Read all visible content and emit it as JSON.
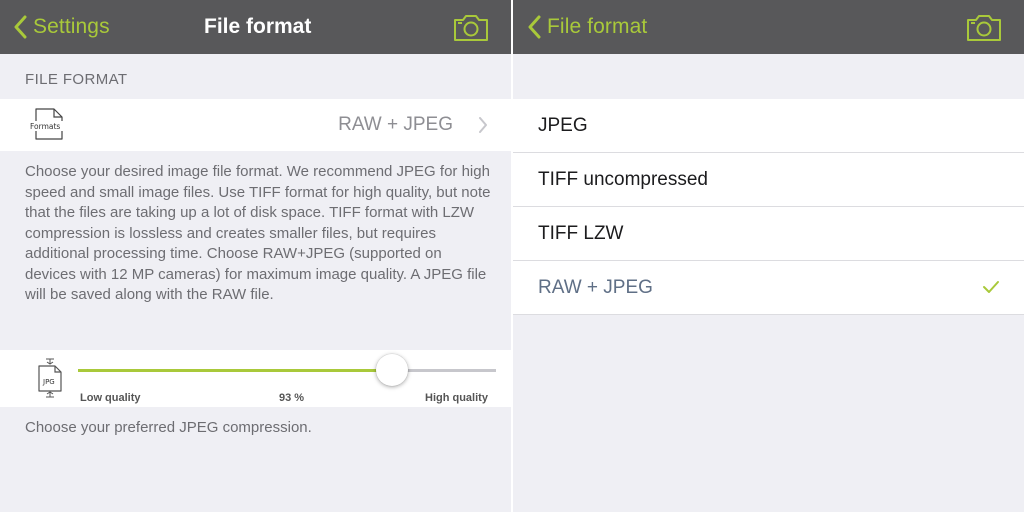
{
  "colors": {
    "accent": "#a9c93a",
    "navbar": "#58585a",
    "grouped_background": "#efeff4",
    "secondary_text": "#6d6d72",
    "selected_option_text": "#5f6f86"
  },
  "left": {
    "navbar": {
      "back_label": "Settings",
      "title": "File format",
      "back_icon": "chevron-left-icon",
      "right_icon": "camera-icon"
    },
    "section_header": "FILE FORMAT",
    "format_row": {
      "icon": "formats-file-icon",
      "icon_text": "Formats",
      "value": "RAW + JPEG",
      "accessory_icon": "chevron-right-icon"
    },
    "description": "Choose your desired image file format. We recommend JPEG for high speed and small image files. Use TIFF format for high quality, but note that the files are taking up a lot of disk space. TIFF format with LZW compression is lossless and creates smaller files, but requires additional processing time. Choose RAW+JPEG (supported on devices with 12 MP cameras) for maximum image quality. A JPEG file will be saved along with the RAW file.",
    "compression_slider": {
      "icon": "jpg-compression-icon",
      "icon_text": "JPG",
      "value_percent": 75,
      "min_label": "Low quality",
      "value_label": "93 %",
      "max_label": "High quality"
    },
    "footer": "Choose your preferred JPEG compression."
  },
  "right": {
    "navbar": {
      "back_label": "File format",
      "back_icon": "chevron-left-icon",
      "right_icon": "camera-icon"
    },
    "options": [
      {
        "label": "JPEG",
        "selected": false
      },
      {
        "label": "TIFF uncompressed",
        "selected": false
      },
      {
        "label": "TIFF LZW",
        "selected": false
      },
      {
        "label": "RAW + JPEG",
        "selected": true
      }
    ],
    "selected_icon": "checkmark-icon"
  }
}
